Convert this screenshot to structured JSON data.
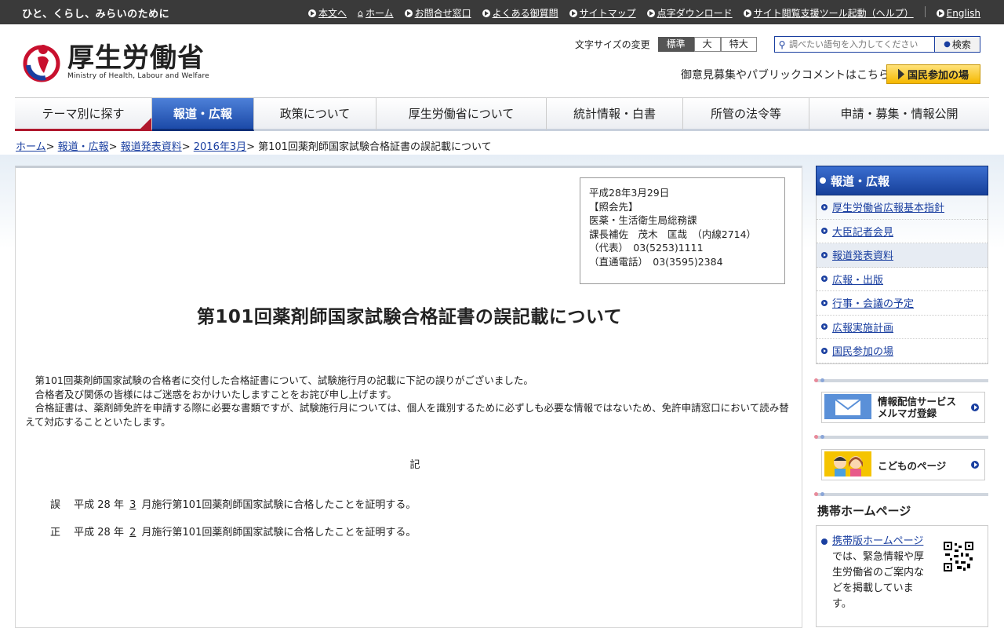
{
  "topbar": {
    "tagline": "ひと、くらし、みらいのために",
    "links": [
      "本文へ",
      "ホーム",
      "お問合せ窓口",
      "よくある御質問",
      "サイトマップ",
      "点字ダウンロード",
      "サイト閲覧支援ツール起動（ヘルプ）",
      "English"
    ]
  },
  "header": {
    "logo_jp": "厚生労働省",
    "logo_en": "Ministry of Health, Labour and Welfare",
    "fontsize_label": "文字サイズの変更",
    "fontsize_options": [
      "標準",
      "大",
      "特大"
    ],
    "search_placeholder": "調べたい語句を入力してください",
    "search_button": "検索",
    "public_comment": "御意見募集やパブリックコメントはこちら",
    "kokumin_button": "国民参加の場"
  },
  "nav": [
    "テーマ別に探す",
    "報道・広報",
    "政策について",
    "厚生労働省について",
    "統計情報・白書",
    "所管の法令等",
    "申請・募集・情報公開"
  ],
  "breadcrumb": {
    "links": [
      "ホーム",
      "報道・広報",
      "報道発表資料",
      "2016年3月"
    ],
    "current": "第101回薬剤師国家試験合格証書の誤記載について"
  },
  "contact": {
    "date": "平成28年3月29日",
    "heading": "【照会先】",
    "dept": "医薬・生活衛生局総務課",
    "person": "課長補佐　茂木　匡哉　（内線2714）",
    "rep": "（代表）　03(5253)1111",
    "direct": "（直通電話）　03(3595)2384"
  },
  "doc": {
    "title": "第101回薬剤師国家試験合格証書の誤記載について",
    "para1": "第101回薬剤師国家試験の合格者に交付した合格証書について、試験施行月の記載に下記の誤りがございました。",
    "para2": "合格者及び関係の皆様にはご迷惑をおかけいたしますことをお詫び申し上げます。",
    "para3": "合格証書は、薬剤師免許を申請する際に必要な書類ですが、試験施行月については、個人を識別するために必ずしも必要な情報ではないため、免許申請窓口において読み替えて対応することといたします。",
    "ki": "記",
    "wrong_label": "誤",
    "wrong_pre": "平成 28 年",
    "wrong_month": "3",
    "wrong_post": "月施行第101回薬剤師国家試験に合格したことを証明する。",
    "right_label": "正",
    "right_pre": "平成 28 年",
    "right_month": "2",
    "right_post": "月施行第101回薬剤師国家試験に合格したことを証明する。"
  },
  "sidebar": {
    "heading": "報道・広報",
    "items": [
      "厚生労働省広報基本指針",
      "大臣記者会見",
      "報道発表資料",
      "広報・出版",
      "行事・会議の予定",
      "広報実施計画",
      "国民参加の場"
    ],
    "banner1_line1": "情報配信サービス",
    "banner1_line2": "メルマガ登録",
    "banner2": "こどものページ",
    "mobile_heading": "携帯ホームページ",
    "mobile_link": "携帯版ホームページ",
    "mobile_text": "では、緊急情報や厚生労働省のご案内などを掲載しています。"
  },
  "colors": {
    "topbar": "#3a3a3a",
    "accent_blue": "#1c4aa8",
    "accent_red": "#b0182e",
    "kokumin_yellow": "#f5b800"
  }
}
